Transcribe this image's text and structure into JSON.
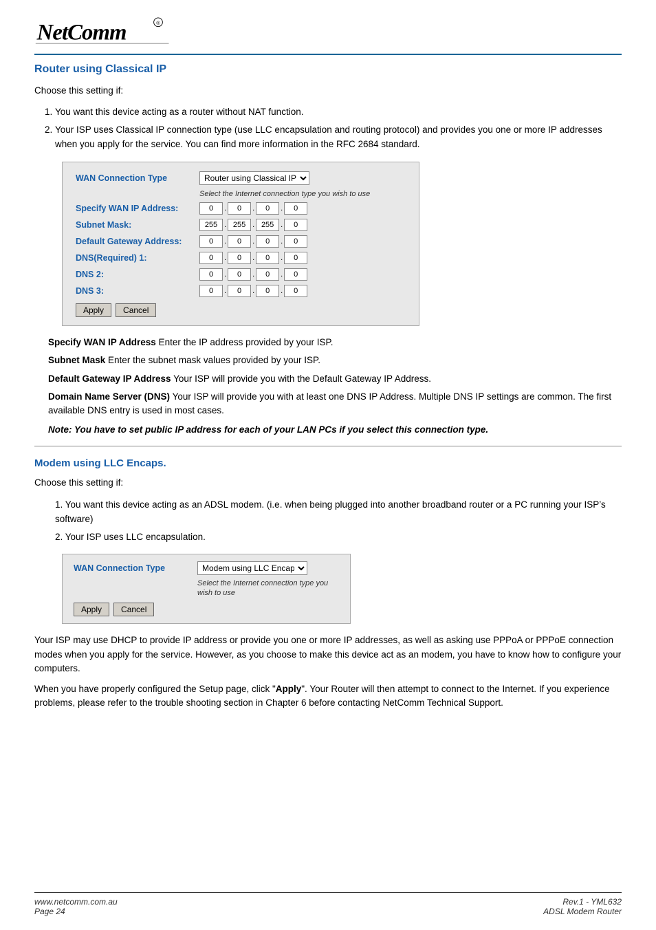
{
  "header": {
    "logo_alt": "NetComm Logo"
  },
  "section1": {
    "heading": "Router using Classical IP",
    "intro": "Choose this setting if:",
    "points": [
      "You want this device acting as a router without NAT function.",
      "Your ISP uses Classical IP connection type (use LLC encapsulation and routing protocol) and provides you one or more IP addresses when you apply for the service. You can find more information in the RFC 2684 standard."
    ]
  },
  "wan_form1": {
    "wan_label": "WAN Connection Type",
    "wan_select_value": "Router using Classical IP",
    "hint": "Select the Internet connection type you wish to use",
    "fields": [
      {
        "label": "Specify WAN IP Address:",
        "octets": [
          "0",
          "0",
          "0",
          "0"
        ]
      },
      {
        "label": "Subnet Mask:",
        "octets": [
          "255",
          "255",
          "255",
          "0"
        ]
      },
      {
        "label": "Default Gateway Address:",
        "octets": [
          "0",
          "0",
          "0",
          "0"
        ]
      },
      {
        "label": "DNS(Required) 1:",
        "octets": [
          "0",
          "0",
          "0",
          "0"
        ]
      },
      {
        "label": "DNS 2:",
        "octets": [
          "0",
          "0",
          "0",
          "0"
        ]
      },
      {
        "label": "DNS 3:",
        "octets": [
          "0",
          "0",
          "0",
          "0"
        ]
      }
    ],
    "apply_btn": "Apply",
    "cancel_btn": "Cancel"
  },
  "descriptions1": [
    {
      "term": "Specify WAN IP Address",
      "desc": "Enter the IP address provided by your ISP."
    },
    {
      "term": "Subnet Mask",
      "desc": "Enter the subnet mask values provided by your ISP."
    },
    {
      "term": "Default Gateway IP Address",
      "desc": "Your ISP will provide you with the Default Gateway IP Address."
    },
    {
      "term": "Domain Name Server (DNS)",
      "desc": "Your ISP will provide you with at least one DNS IP Address. Multiple DNS IP settings are common. The first available DNS entry is used in most cases."
    }
  ],
  "note1": "Note:   You have to set public IP address for each of your LAN PCs if you select this connection type.",
  "section2": {
    "heading": "Modem using LLC Encaps.",
    "intro": "Choose this setting if:",
    "points": [
      "You want this device acting as an ADSL modem. (i.e. when being plugged into another broadband router or a PC running your ISP’s software)",
      "Your ISP uses LLC encapsulation."
    ]
  },
  "wan_form2": {
    "wan_label": "WAN Connection Type",
    "wan_select_value": "Modem using LLC Encaps.",
    "hint": "Select the Internet connection type you wish to use",
    "apply_btn": "Apply",
    "cancel_btn": "Cancel"
  },
  "body_paragraph1": "Your ISP may use DHCP to provide IP address or provide you one or more IP addresses, as well as asking use PPPoA or PPPoE connection modes when you apply for the service. However, as you choose to make this device act as an modem, you have to know how to configure your computers.",
  "body_paragraph2": "When you have properly configured the Setup page, click “Apply”. Your Router will then attempt to connect to the Internet.  If you experience problems, please refer to the trouble shooting section in Chapter 6 before contacting NetComm Technical Support.",
  "footer": {
    "website": "www.netcomm.com.au",
    "page": "Page 24",
    "rev": "Rev.1 - YML632",
    "product": "ADSL Modem Router"
  }
}
